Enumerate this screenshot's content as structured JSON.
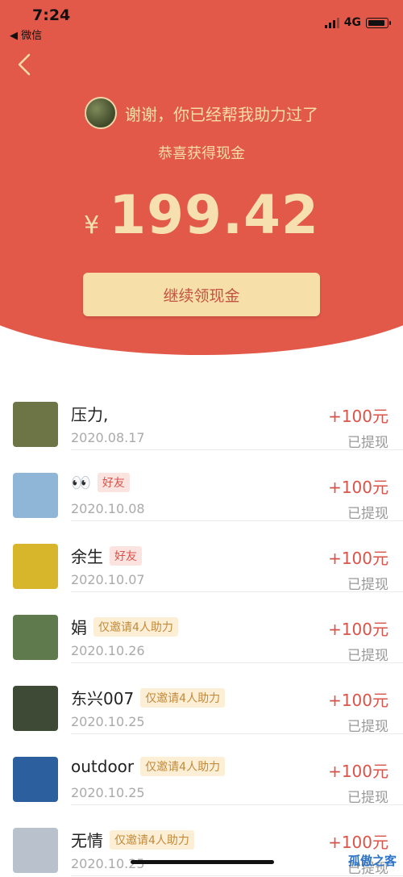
{
  "status_bar": {
    "time": "7:24",
    "back_app": "◀ 微信",
    "network": "4G"
  },
  "header": {
    "inviter_message": "谢谢，你已经帮我助力过了",
    "subtitle": "恭喜获得现金",
    "currency": "¥",
    "amount": "199.42",
    "cta_label": "继续领现金"
  },
  "records": [
    {
      "name": "压力,",
      "badge": "",
      "badge_type": "",
      "date": "2020.08.17",
      "amount": "+100元",
      "status": "已提现",
      "thumb_color": "#6d7446"
    },
    {
      "name": "👀",
      "badge": "好友",
      "badge_type": "friend",
      "date": "2020.10.08",
      "amount": "+100元",
      "status": "已提现",
      "thumb_color": "#8fb6d6"
    },
    {
      "name": "余生",
      "badge": "好友",
      "badge_type": "friend",
      "date": "2020.10.07",
      "amount": "+100元",
      "status": "已提现",
      "thumb_color": "#d8b62c"
    },
    {
      "name": "娟",
      "badge": "仅邀请4人助力",
      "badge_type": "invite",
      "date": "2020.10.26",
      "amount": "+100元",
      "status": "已提现",
      "thumb_color": "#5f7a4c"
    },
    {
      "name": "东兴007",
      "badge": "仅邀请4人助力",
      "badge_type": "invite",
      "date": "2020.10.25",
      "amount": "+100元",
      "status": "已提现",
      "thumb_color": "#3e4a35"
    },
    {
      "name": "outdoor",
      "badge": "仅邀请4人助力",
      "badge_type": "invite",
      "date": "2020.10.25",
      "amount": "+100元",
      "status": "已提现",
      "thumb_color": "#2c5f9e"
    },
    {
      "name": "无情",
      "badge": "仅邀请4人助力",
      "badge_type": "invite",
      "date": "2020.10.25",
      "amount": "+100元",
      "status": "已提现",
      "thumb_color": "#b9c1cc"
    }
  ],
  "watermark": "孤傲之客",
  "colors": {
    "hero_red": "#e2594a",
    "gold_text": "#f6dca8",
    "cta_bg": "#f7dfaa",
    "amount_red": "#d9534a"
  }
}
